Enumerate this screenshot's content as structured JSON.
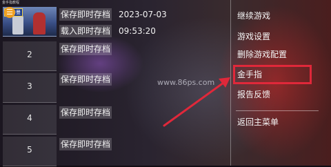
{
  "app": {
    "topbar_text": "金手指教程"
  },
  "menu_icon": {
    "name": "menu-icon",
    "glyph": "☰"
  },
  "slots": [
    {
      "thumb_label": "",
      "has_screenshot": true,
      "badge": "奥特曼",
      "save_label": "保存即时存档",
      "load_label": "载入即时存档",
      "date": "2023-07-03",
      "time": "09:53:20"
    },
    {
      "thumb_label": "2",
      "save_label": "保存即时存档"
    },
    {
      "thumb_label": "3",
      "save_label": "保存即时存档"
    },
    {
      "thumb_label": "4",
      "save_label": "保存即时存档"
    },
    {
      "thumb_label": "5",
      "save_label": "保存即时存档"
    }
  ],
  "side_menu": {
    "items": [
      {
        "label": "继续游戏"
      },
      {
        "label": "游戏设置"
      },
      {
        "label": "删除游戏配置"
      },
      {
        "label": "金手指",
        "highlighted": true
      },
      {
        "label": "报告反馈"
      },
      {
        "label": "返回主菜单"
      }
    ]
  },
  "watermark": "www.86ps.com",
  "colors": {
    "highlight": "#e0283a",
    "menu_icon": "#f0a020"
  }
}
